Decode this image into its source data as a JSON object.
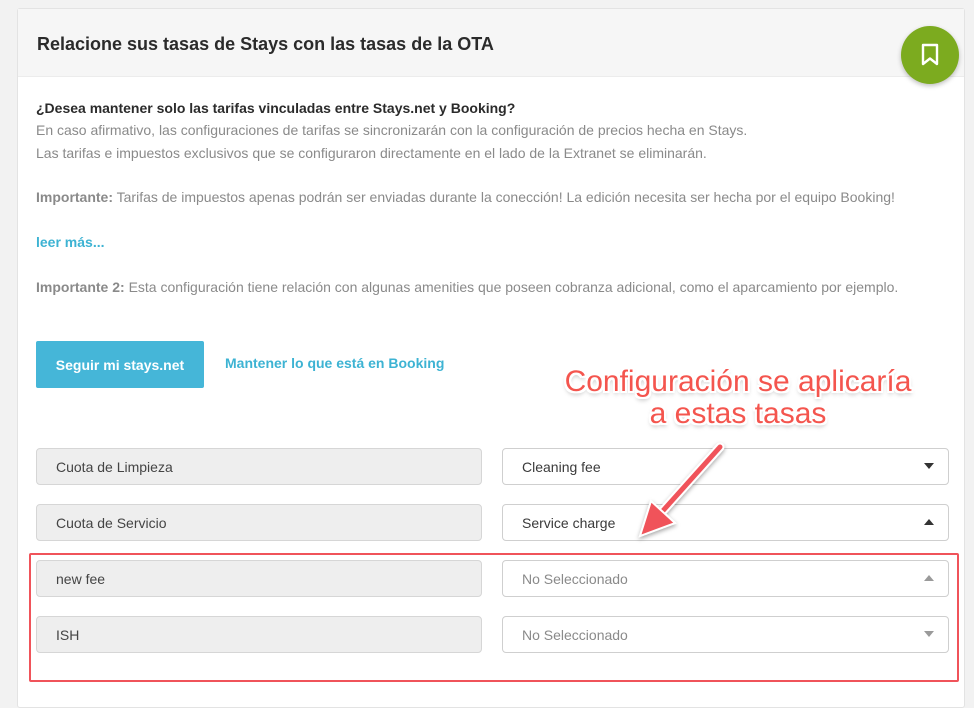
{
  "header": {
    "title": "Relacione sus tasas de Stays con las tasas de la OTA"
  },
  "fab": {
    "icon": "bookmark-icon",
    "color": "#7cab1f"
  },
  "intro": {
    "question": "¿Desea mantener solo las tarifas vinculadas entre Stays.net y Booking?",
    "line1": "En caso afirmativo, las configuraciones de tarifas se sincronizarán con la configuración de precios hecha en Stays.",
    "line2": "Las tarifas e impuestos exclusivos que se configuraron directamente en el lado de la Extranet se eliminarán."
  },
  "important1": {
    "label": "Importante:",
    "text": " Tarifas de impuestos apenas podrán ser enviadas durante la conección! La edición necesita ser hecha por el equipo Booking!",
    "more_link": "leer más..."
  },
  "important2": {
    "label": "Importante 2:",
    "text": " Esta configuración tiene relación con algunas amenities que poseen cobranza adicional, como el aparcamiento por ejemplo."
  },
  "actions": {
    "primary": "Seguir mi stays.net",
    "secondary": "Mantener lo que está en Booking"
  },
  "annotation": {
    "line1": "Configuración se aplicaría",
    "line2": "a estas tasas",
    "color": "#f4554e"
  },
  "mappings": [
    {
      "stays_fee": "Cuota de Limpieza",
      "ota_fee": "Cleaning fee",
      "caret": "down"
    },
    {
      "stays_fee": "Cuota de Servicio",
      "ota_fee": "Service charge",
      "caret": "up"
    },
    {
      "stays_fee": "new fee",
      "ota_fee": "No Seleccionado",
      "caret": "up"
    },
    {
      "stays_fee": "ISH",
      "ota_fee": "No Seleccionado",
      "caret": "down"
    }
  ],
  "colors": {
    "accent": "#45b6d8",
    "link": "#3db3d3",
    "highlight": "#f0535a"
  }
}
